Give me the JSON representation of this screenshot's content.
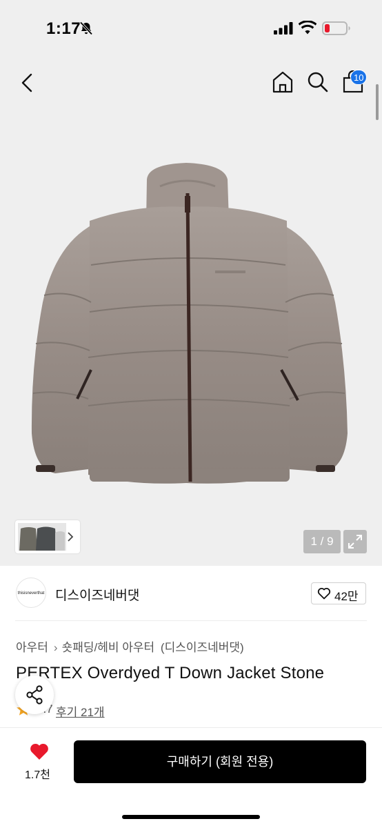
{
  "status_bar": {
    "time": "1:17",
    "icons": [
      "bell-slash-icon",
      "signal-icon",
      "wifi-icon",
      "battery-low-icon"
    ]
  },
  "nav": {
    "back_icon": "chevron-left-icon",
    "home_icon": "home-icon",
    "search_icon": "search-icon",
    "cart_icon": "bag-icon",
    "cart_count": "10"
  },
  "gallery": {
    "pager_text": "1 / 9",
    "expand_icon": "expand-icon",
    "thumb_next_icon": "chevron-right-icon"
  },
  "brand": {
    "logo_text": "thisisneverthat",
    "name": "디스이즈네버댓",
    "like_count": "42만"
  },
  "breadcrumb": {
    "category": "아우터",
    "subcategory": "숏패딩/헤비 아우터",
    "brand_tag": "(디스이즈네버댓)"
  },
  "product": {
    "title": "PERTEX Overdyed T Down Jacket Stone",
    "rating": "4.7",
    "review_link": "후기 21개"
  },
  "bottom_bar": {
    "wish_count": "1.7천",
    "buy_label": "구매하기 (회원 전용)"
  },
  "colors": {
    "accent_badge": "#1a73e8",
    "heart_red": "#e8192c",
    "star": "#f5a623",
    "buy_button": "#000000"
  }
}
